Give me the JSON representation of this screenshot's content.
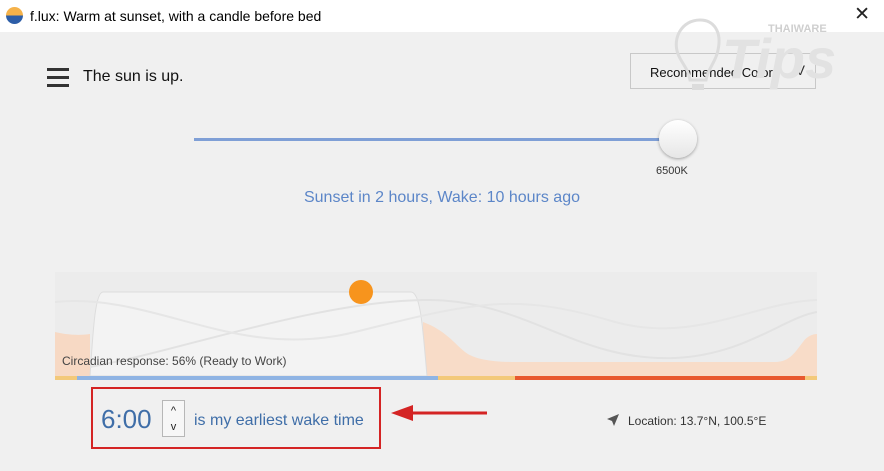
{
  "window": {
    "title": "f.lux: Warm at sunset, with a candle before bed",
    "close_glyph": "✕"
  },
  "header": {
    "status": "The sun is up.",
    "color_mode": "Recommended Colors",
    "dropdown_glyph": "V"
  },
  "slider": {
    "temperature_label": "6500K",
    "level": 1.0
  },
  "sunset_info": "Sunset in 2 hours, Wake: 10 hours ago",
  "graph": {
    "circadian_text": "Circadian response: 56% (Ready to Work)"
  },
  "wake": {
    "time": "6:00",
    "up_glyph": "^",
    "down_glyph": "v",
    "label": "is my earliest wake time"
  },
  "location": {
    "text": "Location: 13.7°N, 100.5°E"
  },
  "watermark": {
    "small": "THAIWARE",
    "big": "Tips"
  },
  "colors": {
    "accent": "#5c86c8",
    "sun": "#f7941d",
    "highlight": "#d42424"
  }
}
